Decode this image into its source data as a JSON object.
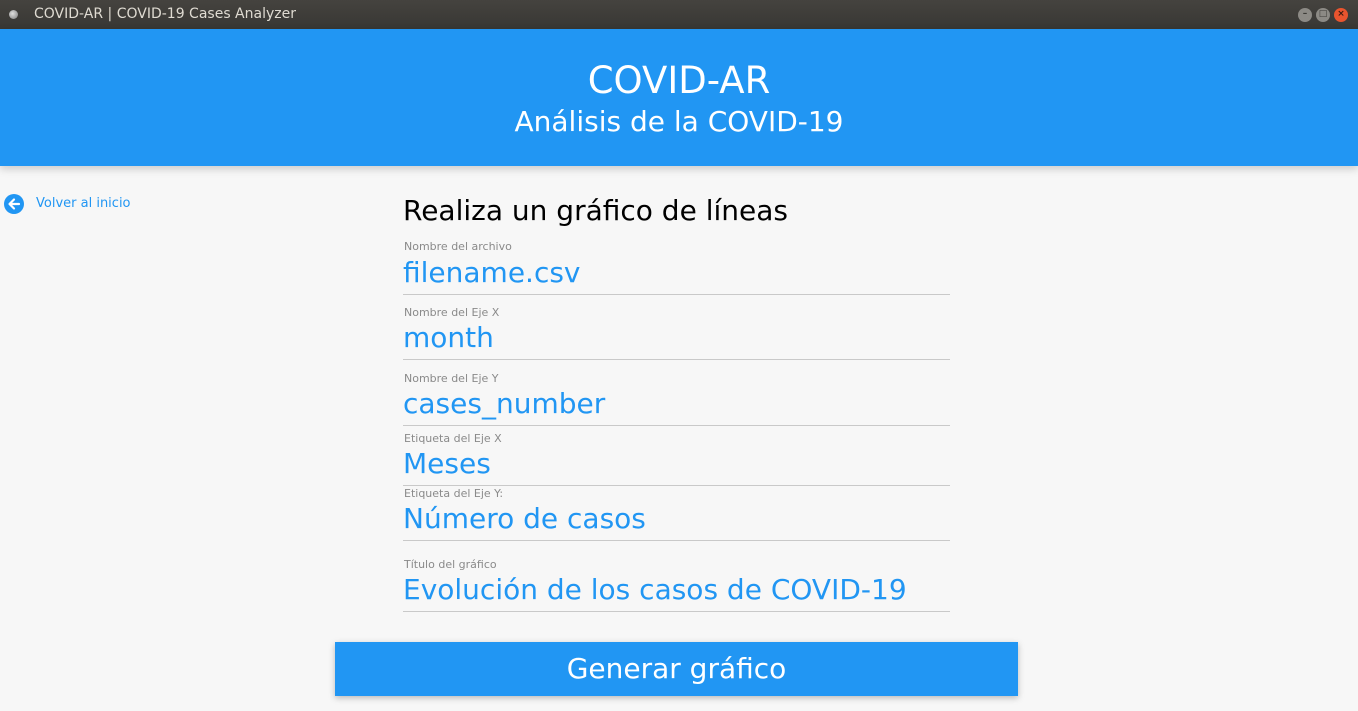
{
  "window": {
    "title": "COVID-AR | COVID-19 Cases Analyzer",
    "min_symbol": "–",
    "max_symbol": "□",
    "close_symbol": "×"
  },
  "header": {
    "title": "COVID-AR",
    "subtitle": "Análisis de la COVID-19"
  },
  "back_link": {
    "label": "Volver al inicio",
    "icon": "arrow-left-icon"
  },
  "form": {
    "title": "Realiza un gráfico de líneas",
    "fields": [
      {
        "label": "Nombre del archivo",
        "value": "filename.csv"
      },
      {
        "label": "Nombre del Eje X",
        "value": "month"
      },
      {
        "label": "Nombre del Eje Y",
        "value": "cases_number"
      },
      {
        "label": "Etiqueta del Eje X",
        "value": "Meses"
      },
      {
        "label": "Etiqueta del Eje Y:",
        "value": "Número de casos"
      },
      {
        "label": "Título del gráfico",
        "value": "Evolución de los casos de COVID-19"
      }
    ],
    "submit_label": "Generar gráfico"
  },
  "colors": {
    "accent": "#2196f3",
    "background": "#f7f7f7",
    "titlebar": "#3c3b37"
  }
}
